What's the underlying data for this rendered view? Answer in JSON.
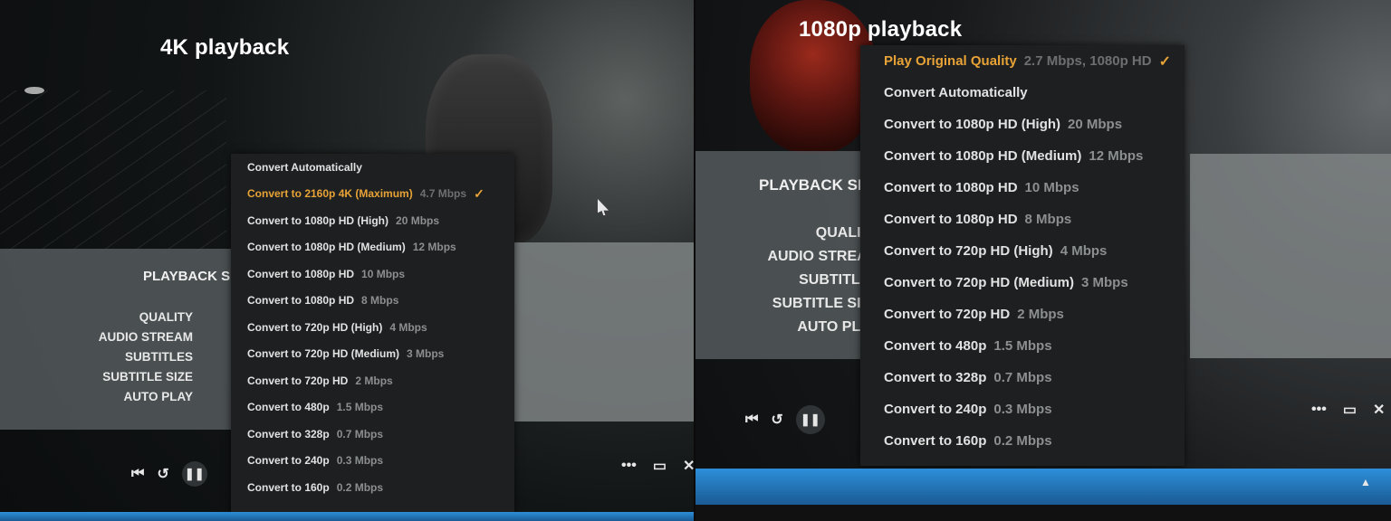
{
  "left": {
    "caption": "4K playback",
    "settings": {
      "title": "PLAYBACK SE",
      "labels": [
        "QUALITY",
        "AUDIO STREAM",
        "SUBTITLES",
        "SUBTITLE SIZE",
        "AUTO PLAY"
      ]
    },
    "menu": [
      {
        "label": "Convert Automatically",
        "rate": ""
      },
      {
        "label": "Convert to 2160p 4K (Maximum)",
        "rate": "4.7 Mbps",
        "selected": true
      },
      {
        "label": "Convert to 1080p HD (High)",
        "rate": "20 Mbps"
      },
      {
        "label": "Convert to 1080p HD (Medium)",
        "rate": "12 Mbps"
      },
      {
        "label": "Convert to 1080p HD",
        "rate": "10 Mbps"
      },
      {
        "label": "Convert to 1080p HD",
        "rate": "8 Mbps"
      },
      {
        "label": "Convert to 720p HD (High)",
        "rate": "4 Mbps"
      },
      {
        "label": "Convert to 720p HD (Medium)",
        "rate": "3 Mbps"
      },
      {
        "label": "Convert to 720p HD",
        "rate": "2 Mbps"
      },
      {
        "label": "Convert to 480p",
        "rate": "1.5 Mbps"
      },
      {
        "label": "Convert to 328p",
        "rate": "0.7 Mbps"
      },
      {
        "label": "Convert to 240p",
        "rate": "0.3 Mbps"
      },
      {
        "label": "Convert to 160p",
        "rate": "0.2 Mbps"
      }
    ]
  },
  "right": {
    "caption": "1080p playback",
    "settings": {
      "title": "PLAYBACK SE",
      "labels": [
        "QUALITY",
        "AUDIO STREAM",
        "SUBTITLES",
        "SUBTITLE SIZE",
        "AUTO PLAY"
      ]
    },
    "menu": [
      {
        "label": "Play Original Quality",
        "rate": "2.7 Mbps, 1080p HD",
        "selected": true
      },
      {
        "label": "Convert Automatically",
        "rate": ""
      },
      {
        "label": "Convert to 1080p HD (High)",
        "rate": "20 Mbps"
      },
      {
        "label": "Convert to 1080p HD (Medium)",
        "rate": "12 Mbps"
      },
      {
        "label": "Convert to 1080p HD",
        "rate": "10 Mbps"
      },
      {
        "label": "Convert to 1080p HD",
        "rate": "8 Mbps"
      },
      {
        "label": "Convert to 720p HD (High)",
        "rate": "4 Mbps"
      },
      {
        "label": "Convert to 720p HD (Medium)",
        "rate": "3 Mbps"
      },
      {
        "label": "Convert to 720p HD",
        "rate": "2 Mbps"
      },
      {
        "label": "Convert to 480p",
        "rate": "1.5 Mbps"
      },
      {
        "label": "Convert to 328p",
        "rate": "0.7 Mbps"
      },
      {
        "label": "Convert to 240p",
        "rate": "0.3 Mbps"
      },
      {
        "label": "Convert to 160p",
        "rate": "0.2 Mbps"
      }
    ]
  },
  "icons": {
    "check": "✓",
    "previous": "⏮",
    "replay": "↺",
    "pause": "❚❚",
    "more": "•••",
    "cast": "▭",
    "close": "✕",
    "tray": "▲"
  },
  "colors": {
    "accent": "#e8a337",
    "menu_bg": "#1d1f20",
    "taskbar": "#2d8fd9"
  }
}
